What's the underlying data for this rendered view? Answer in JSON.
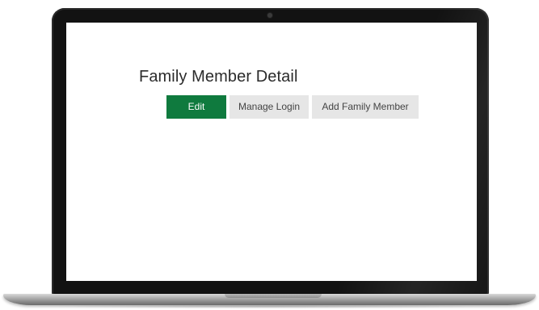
{
  "page": {
    "title": "Family Member Detail"
  },
  "toolbar": {
    "edit_label": "Edit",
    "manage_login_label": "Manage Login",
    "add_family_member_label": "Add Family Member"
  },
  "colors": {
    "primary_button": "#0f7a3e",
    "secondary_button": "#e6e6e6",
    "bezel": "#121212"
  }
}
